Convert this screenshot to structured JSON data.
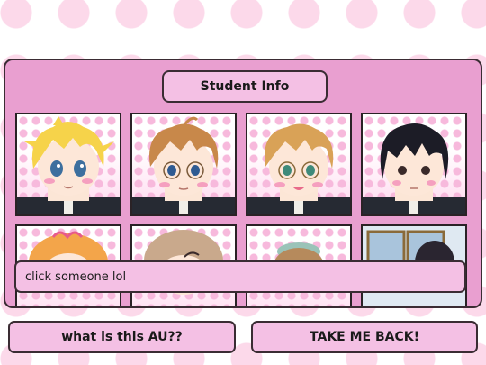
{
  "header": {
    "title": "Student Info"
  },
  "message": {
    "text": "click someone lol"
  },
  "buttons": {
    "au": "what is this AU??",
    "back": "TAKE ME BACK!"
  },
  "students": [
    {
      "icon": "blonde-boy-portrait-icon"
    },
    {
      "icon": "brown-hair-glasses-boy-portrait-icon"
    },
    {
      "icon": "light-brown-hair-glasses-boy-portrait-icon"
    },
    {
      "icon": "black-hair-boy-portrait-icon"
    },
    {
      "icon": "orange-hair-girl-portrait-icon"
    },
    {
      "icon": "light-brown-hair-portrait-icon"
    },
    {
      "icon": "beret-hair-portrait-icon"
    },
    {
      "icon": "dark-hair-window-portrait-icon"
    }
  ],
  "colors": {
    "panel": "#e99fd0",
    "button": "#f4c0e4",
    "border": "#3a2c33",
    "dots": "#fcd9ea"
  }
}
